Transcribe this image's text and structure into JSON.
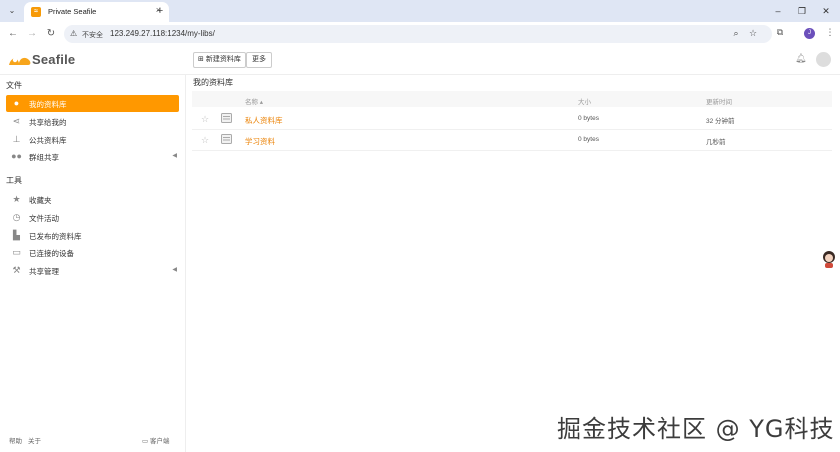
{
  "browser": {
    "tab_title": "Private Seafile",
    "tab_favicon": "seafile-favicon",
    "tab_close": "×",
    "new_tab": "+",
    "security_label": "不安全",
    "url": "123.249.27.118:1234/my-libs/",
    "profile_initial": "J",
    "window_buttons": {
      "minimize": "–",
      "maximize": "❐",
      "close": "✕"
    }
  },
  "header": {
    "logo_text": "Seafile",
    "new_library_label": "新建资料库",
    "more_label": "更多"
  },
  "sidebar": {
    "files_heading": "文件",
    "files_items": [
      {
        "label": "我的资料库",
        "icon": "user-icon",
        "active": true
      },
      {
        "label": "共享给我的",
        "icon": "share-icon"
      },
      {
        "label": "公共资料库",
        "icon": "org-icon"
      },
      {
        "label": "群组共享",
        "icon": "group-icon"
      }
    ],
    "tools_heading": "工具",
    "tools_items": [
      {
        "label": "收藏夹",
        "icon": "star-icon"
      },
      {
        "label": "文件活动",
        "icon": "clock-icon"
      },
      {
        "label": "已发布的资料库",
        "icon": "wiki-icon"
      },
      {
        "label": "已连接的设备",
        "icon": "monitor-icon"
      },
      {
        "label": "共享管理",
        "icon": "wrench-icon"
      }
    ],
    "footer": {
      "help": "帮助",
      "about": "关于",
      "client": "客户端"
    }
  },
  "main": {
    "breadcrumb": "我的资料库",
    "columns": {
      "name": "名称 ▴",
      "size": "大小",
      "modified": "更新时间"
    },
    "rows": [
      {
        "name": "私人资料库",
        "size": "0 bytes",
        "modified": "32 分钟前"
      },
      {
        "name": "学习资料",
        "size": "0 bytes",
        "modified": "几秒前"
      }
    ]
  },
  "watermark": "掘金技术社区 @ YG科技",
  "colors": {
    "accent": "#ff9800",
    "link": "#eb8205",
    "chrome_bg": "#dfe6f4"
  }
}
